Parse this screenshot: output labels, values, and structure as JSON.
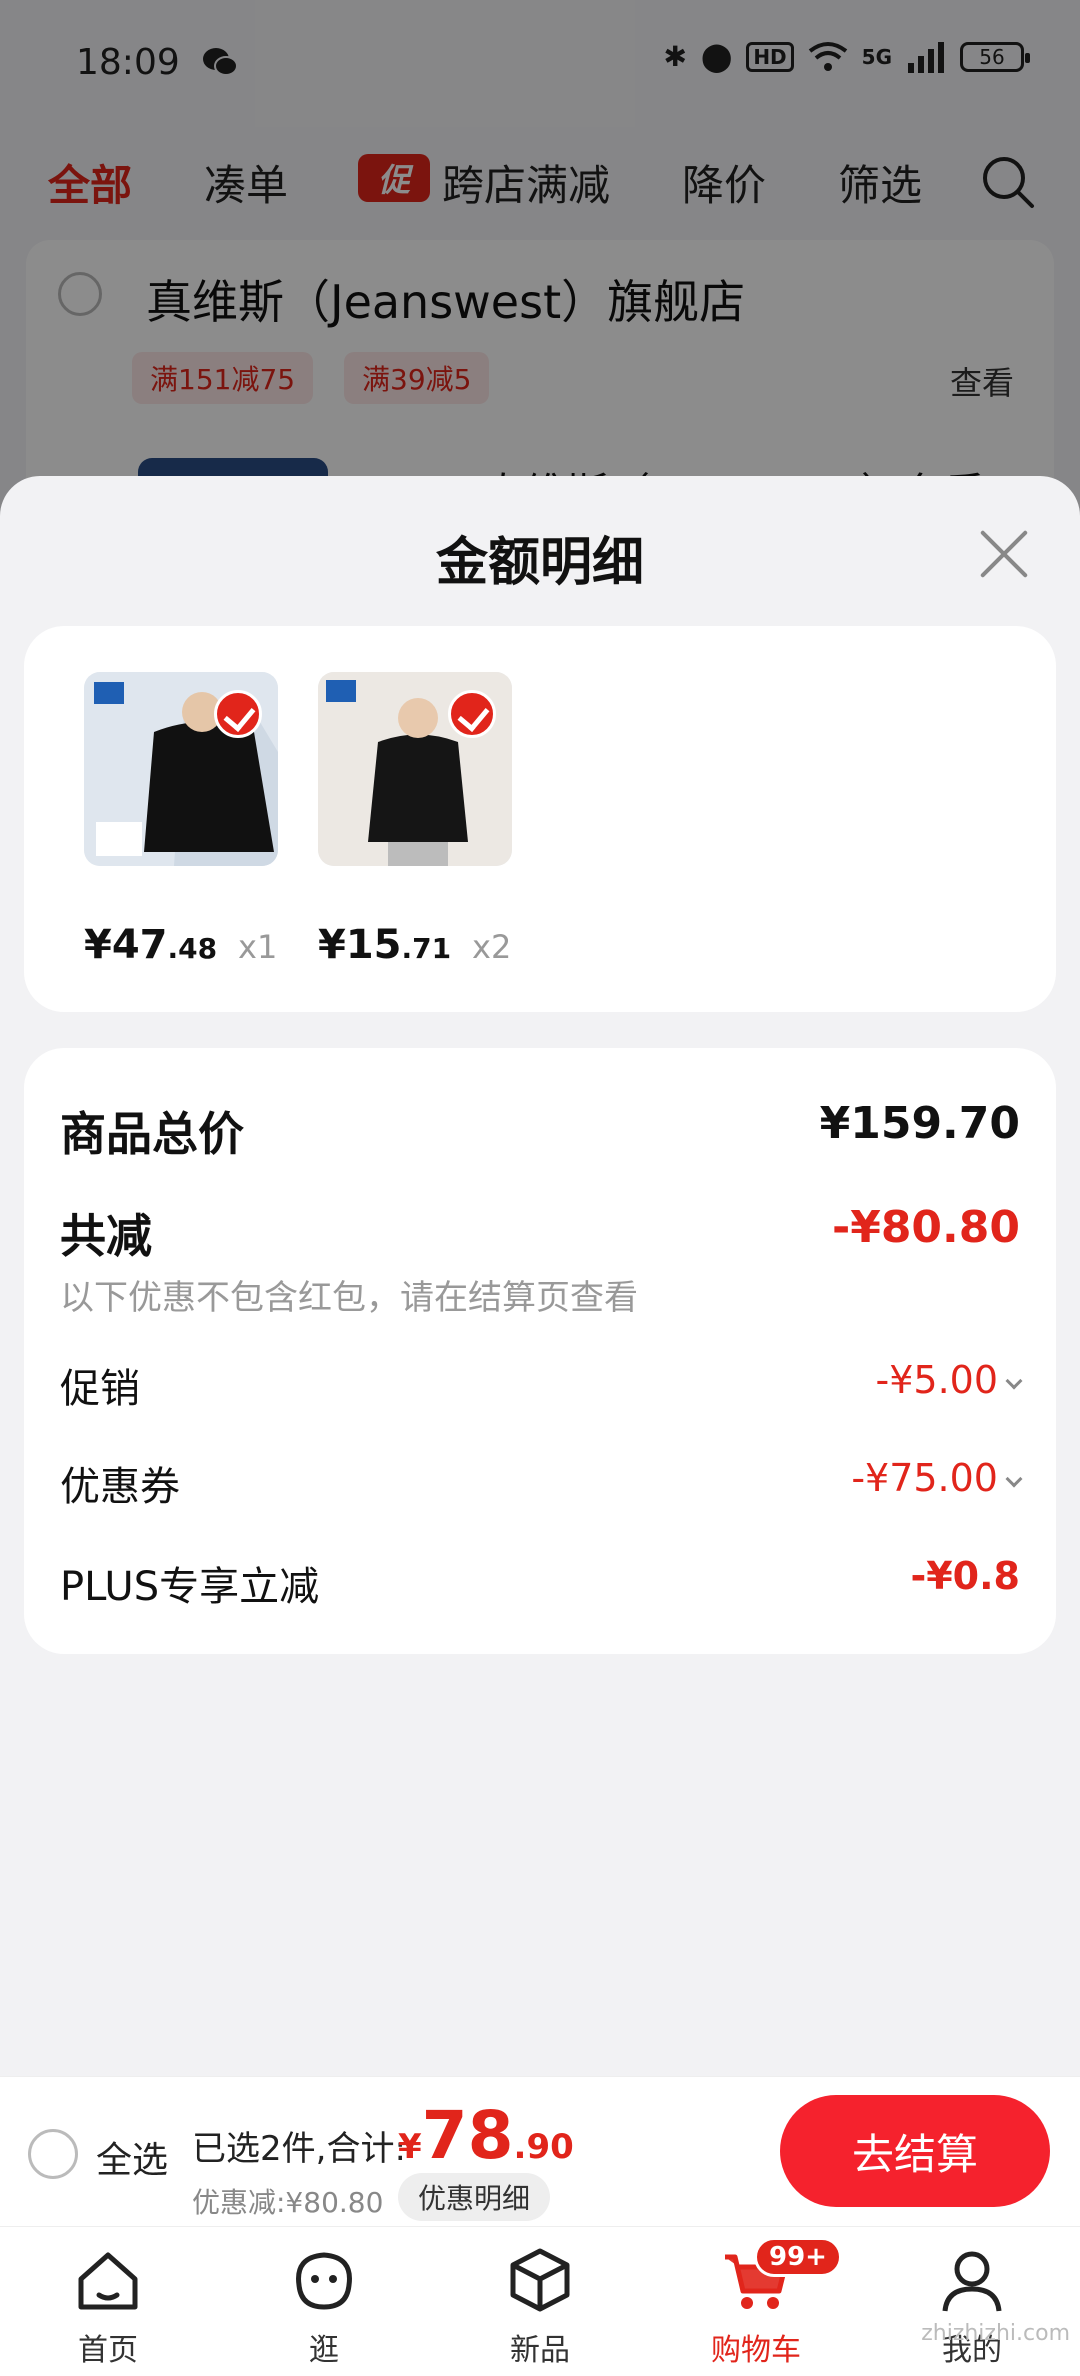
{
  "status_bar": {
    "time": "18:09",
    "network": "5G",
    "battery": "56"
  },
  "top_tabs": {
    "all": "全部",
    "combine": "凑单",
    "promo_tag": "促",
    "cross_store": "跨店满减",
    "price_drop": "降价",
    "filter": "筛选"
  },
  "store": {
    "name": "真维斯（Jeanswest）旗舰店",
    "chips": [
      "满151减75",
      "满39减5"
    ],
    "view_label": "查看",
    "product_title_partial": "真维斯（Jeanswest）冬季"
  },
  "sheet": {
    "title": "金额明细",
    "products": [
      {
        "price_int": "¥47",
        "price_dec": ".48",
        "qty": "x1"
      },
      {
        "price_int": "¥15",
        "price_dec": ".71",
        "qty": "x2"
      }
    ],
    "summary": {
      "total_label": "商品总价",
      "total_value": "¥159.70",
      "reduce_label": "共减",
      "reduce_value": "-¥80.80",
      "reduce_note": "以下优惠不包含红包，请在结算页查看",
      "promotion_label": "促销",
      "promotion_value": "-¥5.00",
      "coupon_label": "优惠券",
      "coupon_value": "-¥75.00",
      "plus_label": "PLUS专享立减",
      "plus_value": "-¥0.8"
    }
  },
  "checkout": {
    "select_all": "全选",
    "selected_text": "已选2件,合计:",
    "total_currency": "¥",
    "total_int": "78",
    "total_dec": ".90",
    "discount_text": "优惠减:¥80.80",
    "detail_button": "优惠明细",
    "checkout_button": "去结算"
  },
  "bottom_nav": {
    "home": "首页",
    "browse": "逛",
    "new": "新品",
    "cart": "购物车",
    "cart_badge": "99+",
    "me": "我的"
  },
  "watermark": "zhizhizhi.com",
  "colors": {
    "accent": "#e1251b",
    "checkout_button": "#f5222d"
  }
}
